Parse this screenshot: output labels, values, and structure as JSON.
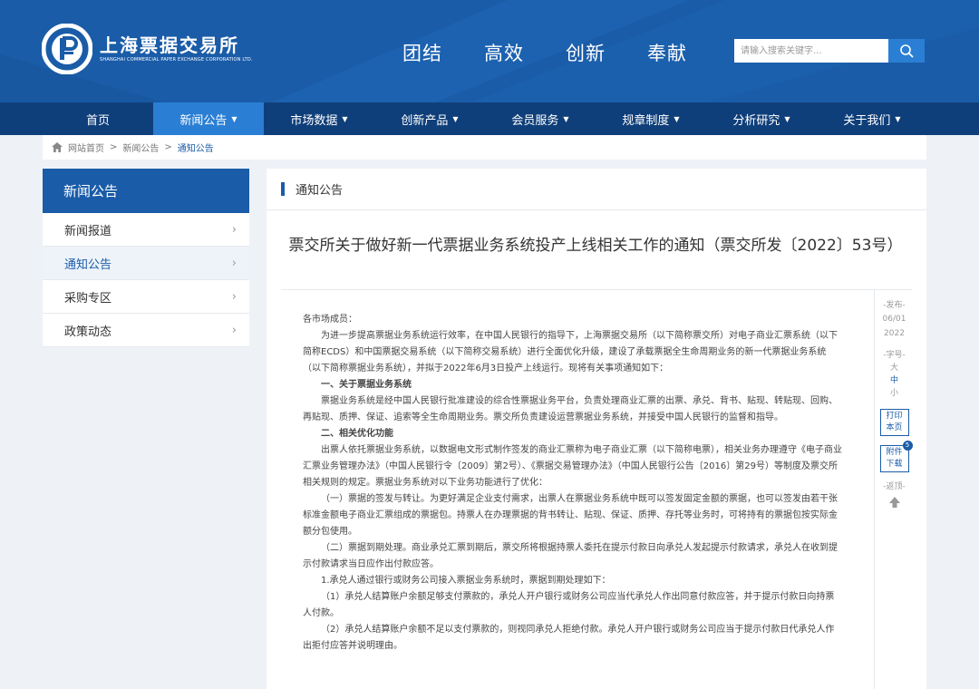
{
  "header": {
    "logo_cn": "上海票据交易所",
    "logo_en": "SHANGHAI COMMERCIAL PAPER EXCHANGE CORPORATION LTD.",
    "slogans": [
      "团结",
      "高效",
      "创新",
      "奉献"
    ],
    "search_placeholder": "请输入搜索关键字...",
    "colors": {
      "primary": "#1a5ca8",
      "nav": "#0f3f7a",
      "accent": "#2a7fd4"
    }
  },
  "nav": {
    "items": [
      {
        "label": "首页",
        "icon": ""
      },
      {
        "label": "新闻公告",
        "icon": "▼"
      },
      {
        "label": "市场数据",
        "icon": "▼"
      },
      {
        "label": "创新产品",
        "icon": "▼"
      },
      {
        "label": "会员服务",
        "icon": "▼"
      },
      {
        "label": "规章制度",
        "icon": "▼"
      },
      {
        "label": "分析研究",
        "icon": "▼"
      },
      {
        "label": "关于我们",
        "icon": "▼"
      }
    ],
    "active": "新闻公告"
  },
  "breadcrumb": {
    "items": [
      "网站首页",
      "新闻公告",
      "通知公告"
    ],
    "separator": ">"
  },
  "sidebar": {
    "title": "新闻公告",
    "items": [
      {
        "label": "新闻报道"
      },
      {
        "label": "通知公告"
      },
      {
        "label": "采购专区"
      },
      {
        "label": "政策动态"
      }
    ],
    "active": "通知公告",
    "arrow": "›"
  },
  "main": {
    "section_title": "通知公告",
    "article_title": "票交所关于做好新一代票据业务系统投产上线相关工作的通知（票交所发〔2022〕53号）",
    "paragraphs": [
      {
        "text": "各市场成员：",
        "style": "noindent"
      },
      {
        "text": "为进一步提高票据业务系统运行效率，在中国人民银行的指导下，上海票据交易所（以下简称票交所）对电子商业汇票系统（以下简称ECDS）和中国票据交易系统（以下简称交易系统）进行全面优化升级，建设了承载票据全生命周期业务的新一代票据业务系统（以下简称票据业务系统），并拟于2022年6月3日投产上线运行。现将有关事项通知如下：",
        "style": ""
      },
      {
        "text": "一、关于票据业务系统",
        "style": "bold"
      },
      {
        "text": "票据业务系统是经中国人民银行批准建设的综合性票据业务平台，负责处理商业汇票的出票、承兑、背书、贴现、转贴现、回购、再贴现、质押、保证、追索等全生命周期业务。票交所负责建设运营票据业务系统，并接受中国人民银行的监督和指导。",
        "style": ""
      },
      {
        "text": "二、相关优化功能",
        "style": "bold"
      },
      {
        "text": "出票人依托票据业务系统，以数据电文形式制作签发的商业汇票称为电子商业汇票（以下简称电票），相关业务办理遵守《电子商业汇票业务管理办法》（中国人民银行令〔2009〕第2号）、《票据交易管理办法》（中国人民银行公告〔2016〕第29号）等制度及票交所相关规则的规定。票据业务系统对以下业务功能进行了优化：",
        "style": ""
      },
      {
        "text": "（一）票据的签发与转让。为更好满足企业支付需求，出票人在票据业务系统中既可以签发固定金额的票据，也可以签发由若干张标准金额电子商业汇票组成的票据包。持票人在办理票据的背书转让、贴现、保证、质押、存托等业务时，可将持有的票据包按实际金额分包使用。",
        "style": ""
      },
      {
        "text": "（二）票据到期处理。商业承兑汇票到期后，票交所将根据持票人委托在提示付款日向承兑人发起提示付款请求，承兑人在收到提示付款请求当日应作出付款应答。",
        "style": ""
      },
      {
        "text": "1.承兑人通过银行或财务公司接入票据业务系统时，票据到期处理如下：",
        "style": ""
      },
      {
        "text": "（1）承兑人结算账户余额足够支付票款的，承兑人开户银行或财务公司应当代承兑人作出同意付款应答，并于提示付款日向持票人付款。",
        "style": ""
      },
      {
        "text": "（2）承兑人结算账户余额不足以支付票款的，则视同承兑人拒绝付款。承兑人开户银行或财务公司应当于提示付款日代承兑人作出拒付应答并说明理由。",
        "style": ""
      }
    ]
  },
  "tools": {
    "publish_label": "-发布-",
    "publish_date_parts": [
      "06/01",
      "2022"
    ],
    "font_label": "-字号-",
    "font_sizes": [
      "大",
      "中",
      "小"
    ],
    "font_selected": "中",
    "print_label": "打印本页",
    "print_lines": [
      "打印",
      "本页"
    ],
    "download_lines": [
      "附件",
      "下载"
    ],
    "attachment_count": "5",
    "back_top_label": "-返顶-"
  }
}
